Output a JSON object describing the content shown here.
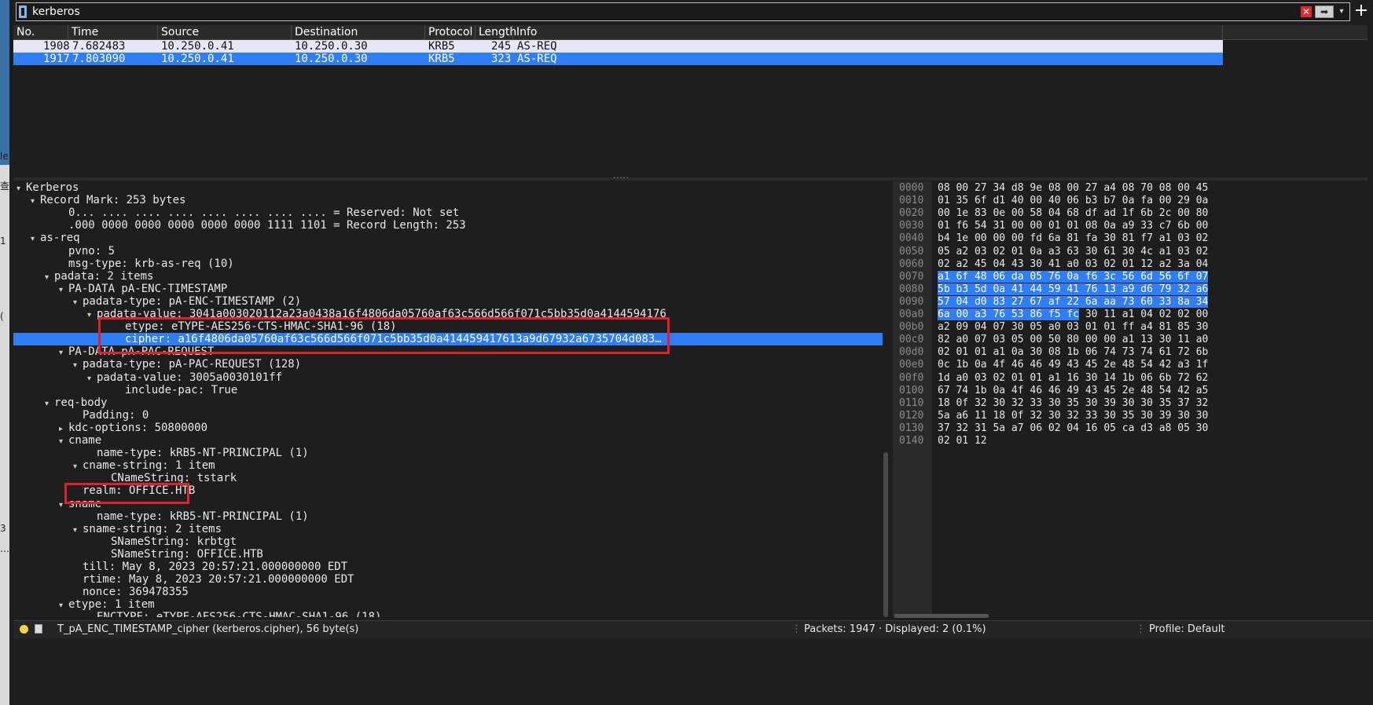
{
  "desktop_strip": {
    "glyphs": [
      "le",
      "查",
      "1",
      "(",
      "3",
      "…"
    ]
  },
  "filter": {
    "value": "kerberos",
    "add_label": "+"
  },
  "packet_columns": [
    "No.",
    "Time",
    "Source",
    "Destination",
    "Protocol",
    "Length",
    "Info"
  ],
  "packets": [
    {
      "no": "1908",
      "time": "7.682483",
      "src": "10.250.0.41",
      "dst": "10.250.0.30",
      "proto": "KRB5",
      "len": "245",
      "info": "AS-REQ"
    },
    {
      "no": "1917",
      "time": "7.803090",
      "src": "10.250.0.41",
      "dst": "10.250.0.30",
      "proto": "KRB5",
      "len": "323",
      "info": "AS-REQ"
    }
  ],
  "details": [
    {
      "indent": 0,
      "arrow": "down",
      "text": "Kerberos"
    },
    {
      "indent": 1,
      "arrow": "down",
      "text": "Record Mark: 253 bytes"
    },
    {
      "indent": 3,
      "arrow": "",
      "text": "0... .... .... .... .... .... .... .... = Reserved: Not set"
    },
    {
      "indent": 3,
      "arrow": "",
      "text": ".000 0000 0000 0000 0000 0000 1111 1101 = Record Length: 253"
    },
    {
      "indent": 1,
      "arrow": "down",
      "text": "as-req"
    },
    {
      "indent": 3,
      "arrow": "",
      "text": "pvno: 5"
    },
    {
      "indent": 3,
      "arrow": "",
      "text": "msg-type: krb-as-req (10)"
    },
    {
      "indent": 2,
      "arrow": "down",
      "text": "padata: 2 items"
    },
    {
      "indent": 3,
      "arrow": "down",
      "text": "PA-DATA pA-ENC-TIMESTAMP"
    },
    {
      "indent": 4,
      "arrow": "down",
      "text": "padata-type: pA-ENC-TIMESTAMP (2)"
    },
    {
      "indent": 5,
      "arrow": "down",
      "text": "padata-value: 3041a003020112a23a0438a16f4806da05760af63c566d566f071c5bb35d0a4144594176"
    },
    {
      "indent": 7,
      "arrow": "",
      "text": "etype: eTYPE-AES256-CTS-HMAC-SHA1-96 (18)"
    },
    {
      "indent": 7,
      "arrow": "",
      "text": "cipher: a16f4806da05760af63c566d566f071c5bb35d0a414459417613a9d67932a6735704d083…",
      "selected": true
    },
    {
      "indent": 3,
      "arrow": "down",
      "text": "PA-DATA pA-PAC-REQUEST"
    },
    {
      "indent": 4,
      "arrow": "down",
      "text": "padata-type: pA-PAC-REQUEST (128)"
    },
    {
      "indent": 5,
      "arrow": "down",
      "text": "padata-value: 3005a0030101ff"
    },
    {
      "indent": 7,
      "arrow": "",
      "text": "include-pac: True"
    },
    {
      "indent": 2,
      "arrow": "down",
      "text": "req-body"
    },
    {
      "indent": 4,
      "arrow": "",
      "text": "Padding: 0"
    },
    {
      "indent": 3,
      "arrow": "right",
      "text": "kdc-options: 50800000"
    },
    {
      "indent": 3,
      "arrow": "down",
      "text": "cname"
    },
    {
      "indent": 5,
      "arrow": "",
      "text": "name-type: kRB5-NT-PRINCIPAL (1)"
    },
    {
      "indent": 4,
      "arrow": "down",
      "text": "cname-string: 1 item"
    },
    {
      "indent": 6,
      "arrow": "",
      "text": "CNameString: tstark"
    },
    {
      "indent": 4,
      "arrow": "",
      "text": "realm: OFFICE.HTB"
    },
    {
      "indent": 3,
      "arrow": "down",
      "text": "sname"
    },
    {
      "indent": 5,
      "arrow": "",
      "text": "name-type: kRB5-NT-PRINCIPAL (1)"
    },
    {
      "indent": 4,
      "arrow": "down",
      "text": "sname-string: 2 items"
    },
    {
      "indent": 6,
      "arrow": "",
      "text": "SNameString: krbtgt"
    },
    {
      "indent": 6,
      "arrow": "",
      "text": "SNameString: OFFICE.HTB"
    },
    {
      "indent": 4,
      "arrow": "",
      "text": "till: May  8, 2023 20:57:21.000000000 EDT"
    },
    {
      "indent": 4,
      "arrow": "",
      "text": "rtime: May  8, 2023 20:57:21.000000000 EDT"
    },
    {
      "indent": 4,
      "arrow": "",
      "text": "nonce: 369478355"
    },
    {
      "indent": 3,
      "arrow": "down",
      "text": "etype: 1 item"
    },
    {
      "indent": 5,
      "arrow": "",
      "text": "ENCTYPE: eTYPE-AES256-CTS-HMAC-SHA1-96 (18)"
    }
  ],
  "bytes": [
    {
      "off": "0000",
      "a": "08 00 27 34 d8 9e 08 00",
      "b": "27 a4 08 70 08 00 45"
    },
    {
      "off": "0010",
      "a": "01 35 6f d1 40 00 40 06",
      "b": "b3 b7 0a fa 00 29 0a"
    },
    {
      "off": "0020",
      "a": "00 1e 83 0e 00 58 04 68",
      "b": "df ad 1f 6b 2c 00 80"
    },
    {
      "off": "0030",
      "a": "01 f6 54 31 00 00 01 01",
      "b": "08 0a a9 33 c7 6b 00"
    },
    {
      "off": "0040",
      "a": "b4 1e 00 00 00 fd 6a 81",
      "b": "fa 30 81 f7 a1 03 02"
    },
    {
      "off": "0050",
      "a": "05 a2 03 02 01 0a a3 63",
      "b": "30 61 30 4c a1 03 02"
    },
    {
      "off": "0060",
      "a": "02 a2 45 04 43 30 41 a0",
      "b": "03 02 01 12 a2 3a 04"
    },
    {
      "off": "0070",
      "a": "a1 6f 48 06 da 05 76 0a",
      "b": "f6 3c 56 6d 56 6f 07",
      "hl": "all"
    },
    {
      "off": "0080",
      "a": "5b b3 5d 0a 41 44 59 41",
      "b": "76 13 a9 d6 79 32 a6",
      "hl": "all"
    },
    {
      "off": "0090",
      "a": "57 04 d0 83 27 67 af 22",
      "b": "6a aa 73 60 33 8a 34",
      "hl": "all"
    },
    {
      "off": "00a0",
      "a": "6a 00 a3 76 53 86 f5 fc",
      "b": "30 11 a1 04 02 02 00",
      "hl": "a"
    },
    {
      "off": "00b0",
      "a": "a2 09 04 07 30 05 a0 03",
      "b": "01 01 ff a4 81 85 30"
    },
    {
      "off": "00c0",
      "a": "82 a0 07 03 05 00 50 80",
      "b": "00 00 a1 13 30 11 a0"
    },
    {
      "off": "00d0",
      "a": "02 01 01 a1 0a 30 08 1b",
      "b": "06 74 73 74 61 72 6b"
    },
    {
      "off": "00e0",
      "a": "0c 1b 0a 4f 46 46 49 43",
      "b": "45 2e 48 54 42 a3 1f"
    },
    {
      "off": "00f0",
      "a": "1d a0 03 02 01 01 a1 16",
      "b": "30 14 1b 06 6b 72 62"
    },
    {
      "off": "0100",
      "a": "67 74 1b 0a 4f 46 46 49",
      "b": "43 45 2e 48 54 42 a5"
    },
    {
      "off": "0110",
      "a": "18 0f 32 30 32 33 30 35",
      "b": "30 39 30 30 35 37 32"
    },
    {
      "off": "0120",
      "a": "5a a6 11 18 0f 32 30 32",
      "b": "33 30 35 30 39 30 30"
    },
    {
      "off": "0130",
      "a": "37 32 31 5a a7 06 02 04",
      "b": "16 05 ca d3 a8 05 30"
    },
    {
      "off": "0140",
      "a": "02 01 12",
      "b": ""
    }
  ],
  "status": {
    "field_text": "T_pA_ENC_TIMESTAMP_cipher (kerberos.cipher), 56 byte(s)",
    "packets_text": "Packets: 1947 · Displayed: 2 (0.1%)",
    "profile_text": "Profile: Default"
  },
  "colors": {
    "selection": "#2f7ef5",
    "annotation": "#e0202a",
    "status_led": "#f2d14b"
  }
}
